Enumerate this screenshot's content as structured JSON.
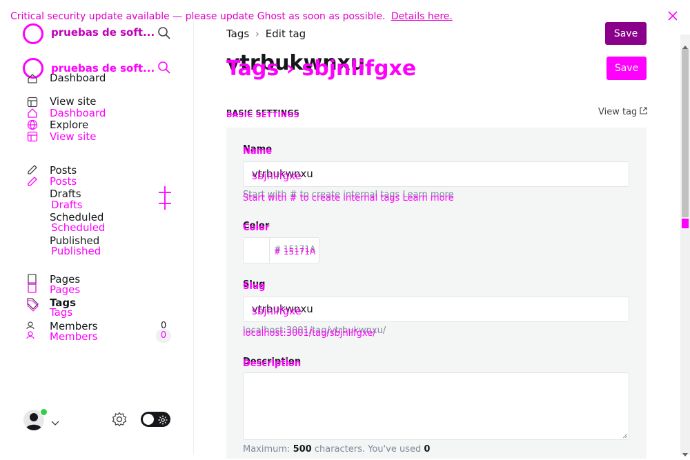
{
  "banner": {
    "text": "Critical security update available — please update Ghost as soon as possible.",
    "link": "Details here."
  },
  "sidebar": {
    "site_title": "pruebas de soft...",
    "site_title_overlay": "pruebas de soft...",
    "items_back": [
      "Dashboard",
      "View site"
    ],
    "items_front": [
      "Dashboard",
      "Explore",
      "View site"
    ],
    "posts": {
      "label": "Posts",
      "label_overlay": "Posts"
    },
    "post_subs": [
      "Drafts",
      "Scheduled",
      "Published"
    ],
    "post_subs_overlay": [
      "Drafts",
      "Scheduled",
      "Published"
    ],
    "pages": {
      "label": "Pages",
      "label_overlay": "Pages"
    },
    "tags": {
      "label": "Tags",
      "label_overlay": "Tags"
    },
    "members": {
      "label": "Members",
      "label_overlay": "Members",
      "count": "0",
      "count_overlay": "0"
    }
  },
  "header": {
    "breadcrumb_parent": "Tags",
    "breadcrumb_current": "Edit tag",
    "save_label": "Save",
    "save_label_overlay": "Save",
    "title": "vtrbukwnxu",
    "title_overlay": "Tags › sbjnlifgxe"
  },
  "basic_settings": {
    "heading": "BASIC SETTINGS",
    "heading_overlay": "BASIC SETTINGS",
    "view_tag": "View tag"
  },
  "form": {
    "name_label": "Name",
    "name_label_overlay": "Name",
    "name_value": "vtrbukwnxu",
    "name_value_overlay": "sbjnlifgxe",
    "name_hint": "Start with # to create internal tags Learn more",
    "name_hint_overlay": "Start with # to create internal tags Learn more",
    "color_label": "Color",
    "color_label_overlay": "Color",
    "color_value": "# 15171A",
    "color_value_overlay": "# 15171A",
    "slug_label": "Slug",
    "slug_label_overlay": "Slug",
    "slug_value": "vtrbukwnxu",
    "slug_value_overlay": "sbjnlifgxe",
    "slug_url": "localhost:3001/tag/vtrbukwnxu/",
    "slug_url_overlay": "localhost:3001/tag/sbjnlifgxe/",
    "desc_label": "Description",
    "desc_label_overlay": "Description",
    "desc_hint_prefix": "Maximum: ",
    "desc_hint_max": "500",
    "desc_hint_mid": " characters. You've used ",
    "desc_hint_used": "0"
  },
  "colors": {
    "accent": "#ff00ff",
    "save_dark": "#8b008b",
    "panel": "#f4f5f5",
    "toggle": "#15171a"
  }
}
